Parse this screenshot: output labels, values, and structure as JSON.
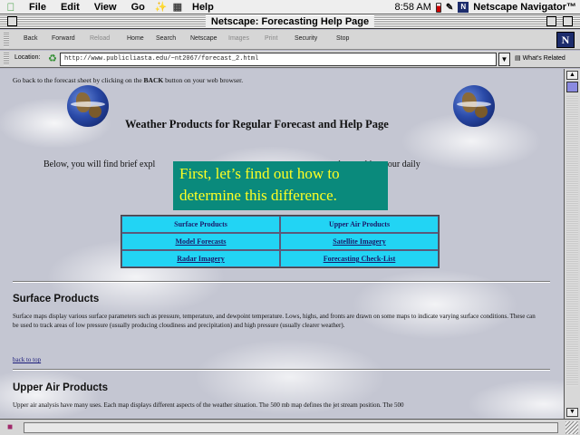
{
  "menubar": {
    "items": [
      "File",
      "Edit",
      "View",
      "Go",
      "Help"
    ],
    "clock": "8:58 AM",
    "app_name": "Netscape Navigator™"
  },
  "window": {
    "title": "Netscape: Forecasting Help Page"
  },
  "toolbar": {
    "buttons": [
      "Back",
      "Forward",
      "Reload",
      "Home",
      "Search",
      "Netscape",
      "Images",
      "Print",
      "Security",
      "Stop"
    ],
    "logo": "N"
  },
  "location": {
    "label": "Location:",
    "url": "http://www.publicliasta.edu/~nt2067/forecast_2.html",
    "whats_related": "What's Related"
  },
  "page": {
    "back_instruction_pre": "Go back to the forecast sheet by clicking on the ",
    "back_instruction_bold": "BACK",
    "back_instruction_post": " button on your web browser.",
    "heading": "Weather Products for Regular Forecast and Help Page",
    "intro_left": "Below, you will find brief expl",
    "intro_right": "p you when making your daily",
    "overlay_line1": "First, let’s find out how to",
    "overlay_line2": "determine this difference.",
    "nav": {
      "surface_products": "Surface Products",
      "upper_air_products": "Upper Air Products",
      "model_forecasts": "Model Forecasts",
      "satellite_imagery": "Satellite Imagery",
      "radar_imagery": "Radar Imagery",
      "forecasting_checklist": "Forecasting Check-List"
    },
    "surface_heading": "Surface Products",
    "surface_body": "Surface maps display various surface parameters such as pressure, temperature, and dewpoint temperature. Lows, highs, and fronts are drawn on some maps to indicate varying surface conditions. These can be used to track areas of low pressure (usually producing cloudiness and precipitation) and high pressure (usually clearer weather).",
    "back_to_top": "back to top",
    "upper_heading": "Upper Air Products",
    "upper_body": "Upper air analysis have many uses. Each map displays different aspects of the weather situation. The 500 mb map defines the jet stream position. The 500"
  }
}
